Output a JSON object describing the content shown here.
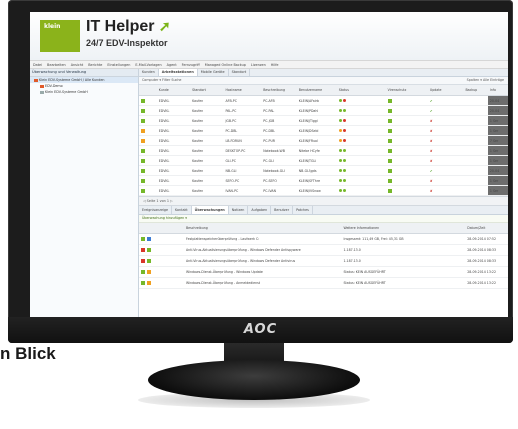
{
  "app": {
    "logo_text": "klein",
    "title": "IT Helper",
    "subtitle": "24/7 EDV-Inspektor",
    "brand": "AOC",
    "caption": "n Blick"
  },
  "colors": {
    "accent": "#8bb31b",
    "ok": "#76b82a",
    "error": "#d9362a",
    "warning": "#f0a020"
  },
  "menu": [
    "Datei",
    "Bearbeiten",
    "Ansicht",
    "Berichte",
    "Einstellungen",
    "E-Mail-Vorlagen",
    "Agent",
    "Fernzugriff",
    "Managed Online Backup",
    "Lizenzen",
    "Hilfe"
  ],
  "sidebar": {
    "title": "Überwachung und Verwaltung",
    "items": [
      {
        "label": "Klein EDV-Systeme GmbH / Alle Kunden",
        "icon": "folder-icon"
      },
      {
        "label": "EDV-Demo",
        "icon": "client-icon"
      },
      {
        "label": "Klein EDV-Systeme GmbH",
        "icon": "client-icon"
      }
    ]
  },
  "tabs": [
    "Kunden",
    "Arbeitsstationen",
    "Mobile Geräte",
    "Standort"
  ],
  "toolbar": {
    "left": "Computer ▾   Filter   Suche",
    "right": "Spalten ▾   Alle Einträge"
  },
  "grid": {
    "columns": [
      "",
      "Kunde",
      "Standort",
      "Hostname",
      "Beschreibung",
      "Benutzername",
      "Status",
      "Virenschutz",
      "Update",
      "Backup",
      "Info"
    ],
    "rows": [
      {
        "kunde": "EDVKL",
        "standort": "Kaufen",
        "host": "AFB-PC",
        "desc": "PC-AFB",
        "user": "KLEIN\\AFairb",
        "s1": "g",
        "s2": "r",
        "ok": "✔",
        "info": "20-04"
      },
      {
        "kunde": "EDVKL",
        "standort": "Kaufen",
        "host": "PAL-PC",
        "desc": "PC-PAL",
        "user": "KLEIN\\PDahl",
        "s1": "g",
        "s2": "g",
        "ok": "✔",
        "info": "20-04"
      },
      {
        "kunde": "EDVKL",
        "standort": "Kaufen",
        "host": "JGB-PC",
        "desc": "PC-JGB",
        "user": "KLEIN\\JTiggi",
        "s1": "g",
        "s2": "r",
        "ok": "✘",
        "info": "1 Ser"
      },
      {
        "kunde": "EDVKL",
        "standort": "Kaufen",
        "host": "PC-DBL",
        "desc": "PC-DBL",
        "user": "KLEIN\\DSebl",
        "s1": "o",
        "s2": "r",
        "ok": "✘",
        "info": "1 Ser"
      },
      {
        "kunde": "EDVKL",
        "standort": "Kaufen",
        "host": "LB-FDRUN",
        "desc": "PC-PUR",
        "user": "KLEIN\\FRuol",
        "s1": "o",
        "s2": "r",
        "ok": "✘",
        "info": "7 Ser"
      },
      {
        "kunde": "EDVKL",
        "standort": "Kaufen",
        "host": "DESKTOP-PC",
        "desc": "Notebook-WB",
        "user": "Nitebe HCyfe",
        "s1": "g",
        "s2": "g",
        "ok": "✘",
        "info": "1 Ser"
      },
      {
        "kunde": "EDVKL",
        "standort": "Kaufen",
        "host": "GLI-PC",
        "desc": "PC-GLI",
        "user": "KLEIN\\TGLi",
        "s1": "g",
        "s2": "g",
        "ok": "✘",
        "info": "1 Ser"
      },
      {
        "kunde": "EDVKL",
        "standort": "Kaufen",
        "host": "NB-GLI",
        "desc": "Notebook-GLI",
        "user": "NB-GLI\\gds",
        "s1": "g",
        "s2": "g",
        "ok": "✔",
        "info": "20-04"
      },
      {
        "kunde": "EDVKL",
        "standort": "Kaufen",
        "host": "SEFO-PC",
        "desc": "PC-SEFO",
        "user": "KLEIN\\SFThre",
        "s1": "g",
        "s2": "g",
        "ok": "✘",
        "info": "1 Ser"
      },
      {
        "kunde": "EDVKL",
        "standort": "Kaufen",
        "host": "IVAN-PC",
        "desc": "PC-IVAN",
        "user": "KLEIN\\IVSnow",
        "s1": "g",
        "s2": "g",
        "ok": "✘",
        "info": "1 Ser"
      }
    ]
  },
  "pager": {
    "text": "◁   Seite  1   von 1   ▷ "
  },
  "bottom_tabs": [
    "Ereignisanzeige",
    "Kontakt",
    "Überwachungen",
    "Notizen",
    "Aufgaben",
    "Benutzer",
    "Patches"
  ],
  "monitoring": {
    "add_label": "Überwachung hinzufügen ▾",
    "columns": [
      "Beschreibung",
      "Weitere Informationen",
      "Datum/Zeit"
    ],
    "rows": [
      {
        "desc": "Festplattenspeicherüberprüfung - Laufwerk C:",
        "info": "Insgesamt: 111,49 GB, Frei: 45,31 GB",
        "date": "28-09-2014 07:52"
      },
      {
        "desc": "Anti-Virus-Aktualisierungsüberprüfung - Windows Defender Antispyware",
        "info": "1.187.13.0",
        "date": "28-09-2014 08:33"
      },
      {
        "desc": "Anti-Virus-Aktualisierungsüberprüfung - Windows Defender Antivirus",
        "info": "1.187.13.0",
        "date": "28-09-2014 08:33"
      },
      {
        "desc": "Windows-Dienst-Überprüfung - Windows Update",
        "info": "Status: KEIN AUSGEFÜHRT",
        "date": "28-09-2014 13:22"
      },
      {
        "desc": "Windows-Dienst-Überprüfung - Anmeldedienst",
        "info": "Status: KEIN AUSGEFÜHRT",
        "date": "28-09-2014 13:22"
      }
    ]
  }
}
